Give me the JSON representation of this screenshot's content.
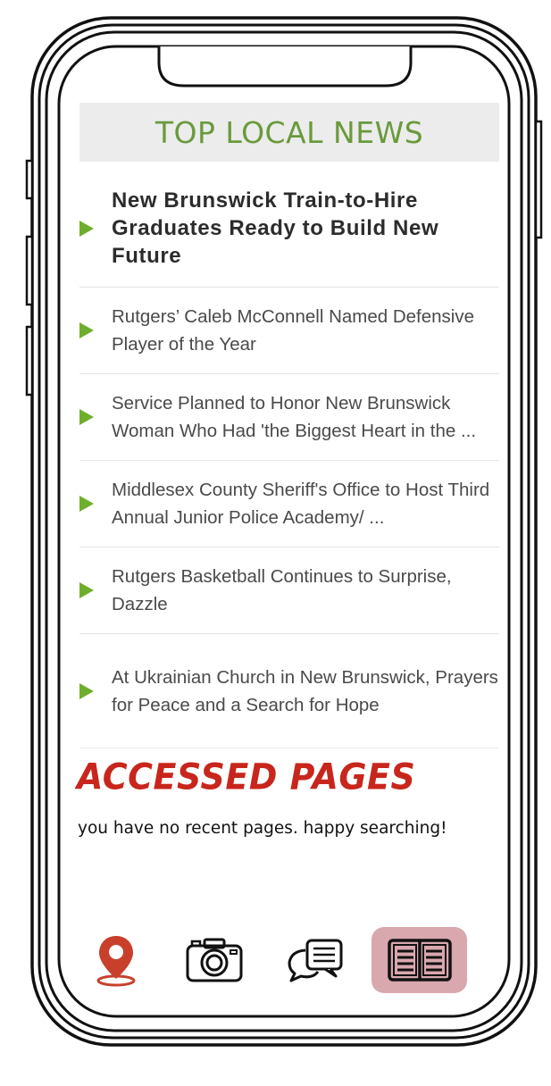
{
  "news": {
    "header": "TOP LOCAL NEWS",
    "items": [
      {
        "title": "New Brunswick Train-to-Hire Graduates Ready to Build New Future"
      },
      {
        "title": "Rutgers’ Caleb McConnell Named Defensive Player of the Year"
      },
      {
        "title": "Service Planned to Honor New Brunswick Woman Who Had 'the Biggest Heart in the ..."
      },
      {
        "title": "Middlesex County Sheriff's Office to Host Third Annual Junior Police Academy/ ..."
      },
      {
        "title": "Rutgers Basketball Continues to Surprise, Dazzle"
      },
      {
        "title": "At Ukrainian Church in New Brunswick, Prayers for Peace and a Search for Hope"
      }
    ]
  },
  "accessed": {
    "title": "ACCESSED PAGES",
    "message": "you have no recent pages. happy searching!"
  },
  "nav": {
    "items": [
      {
        "icon": "location-pin-icon",
        "selected": false
      },
      {
        "icon": "camera-icon",
        "selected": false
      },
      {
        "icon": "chat-bubbles-icon",
        "selected": false
      },
      {
        "icon": "book-icon",
        "selected": true
      }
    ]
  },
  "colors": {
    "header_text": "#6a9a3c",
    "header_bg": "#ececec",
    "bullet": "#6fae2c",
    "accessed_title": "#c8261c",
    "location_icon": "#c8402c",
    "selected_tab_bg": "#d9a7ae"
  }
}
